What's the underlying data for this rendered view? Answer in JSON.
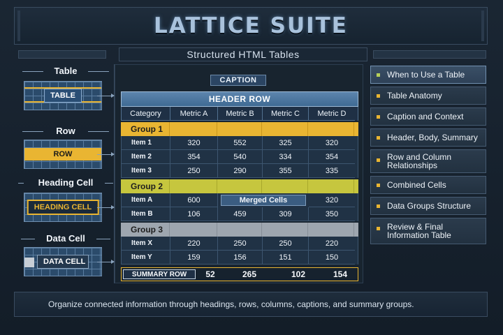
{
  "app": {
    "title": "LATTICE SUITE",
    "subtitle": "Structured HTML Tables"
  },
  "legend": [
    {
      "label": "Table",
      "tag": "TABLE"
    },
    {
      "label": "Row",
      "tag": "ROW"
    },
    {
      "label": "Heading Cell",
      "tag": "HEADING CELL"
    },
    {
      "label": "Data Cell",
      "tag": "DATA CELL"
    }
  ],
  "table": {
    "caption": "CAPTION",
    "header_row": "HEADER ROW",
    "columns": [
      "Category",
      "Metric A",
      "Metric B",
      "Metric C",
      "Metric D"
    ],
    "groups": [
      {
        "name": "Group 1",
        "rows": [
          [
            "Item 1",
            "320",
            "552",
            "325",
            "320"
          ],
          [
            "Item 2",
            "354",
            "540",
            "334",
            "354"
          ],
          [
            "Item 3",
            "250",
            "290",
            "355",
            "335"
          ]
        ]
      },
      {
        "name": "Group 2",
        "rows": [
          [
            "Item A",
            "600",
            "Merged Cells",
            "",
            "320"
          ],
          [
            "Item B",
            "106",
            "459",
            "309",
            "350"
          ]
        ]
      },
      {
        "name": "Group 3",
        "rows": [
          [
            "Item X",
            "220",
            "250",
            "250",
            "220"
          ],
          [
            "Item Y",
            "159",
            "156",
            "151",
            "150"
          ]
        ]
      }
    ],
    "summary": {
      "label": "SUMMARY ROW",
      "values": [
        "52",
        "265",
        "102",
        "154"
      ]
    }
  },
  "menu": [
    {
      "label": "When to Use a Table",
      "active": true
    },
    {
      "label": "Table Anatomy"
    },
    {
      "label": "Caption and Context"
    },
    {
      "label": "Header, Body, Summary"
    },
    {
      "label": "Row and Column Relationships"
    },
    {
      "label": "Combined Cells"
    },
    {
      "label": "Data Groups Structure"
    },
    {
      "label": "Review & Final Information Table"
    }
  ],
  "footer": {
    "text": "Organize connected information through headings, rows, columns, captions, and summary groups."
  },
  "colors": {
    "accent": "#e9b532",
    "group2": "#c6c63e",
    "group3": "#9ea6af",
    "header": "#4f7aa3",
    "active_bullet": "#b7d05a"
  }
}
